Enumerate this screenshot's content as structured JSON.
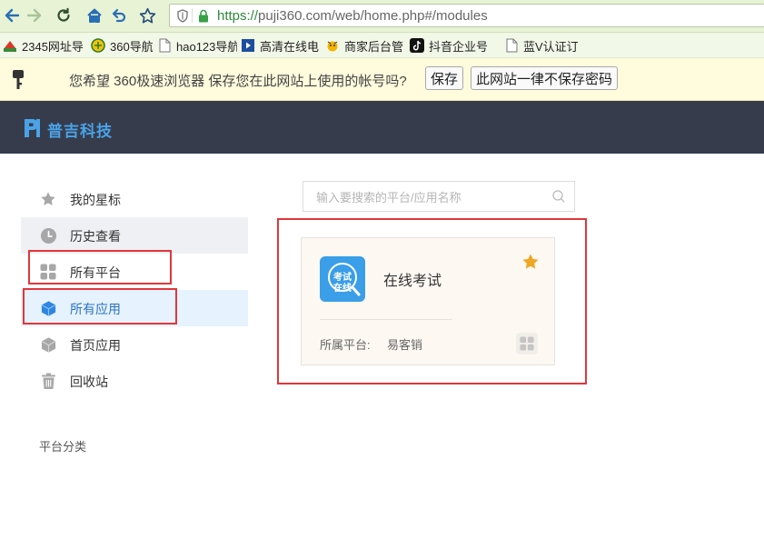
{
  "browser": {
    "url_https": "https://",
    "url_rest": "puji360.com/web/home.php#/modules",
    "bookmarks": [
      {
        "label": "2345网址导",
        "icon": "2345-icon"
      },
      {
        "label": "360导航",
        "icon": "360-icon"
      },
      {
        "label": "hao123导航",
        "icon": "page-icon"
      },
      {
        "label": "高清在线电",
        "icon": "film-icon"
      },
      {
        "label": "商家后台管",
        "icon": "shop-icon"
      },
      {
        "label": "抖音企业号",
        "icon": "tiktok-icon"
      },
      {
        "label": "蓝V认证订",
        "icon": "page-icon"
      }
    ]
  },
  "password_bar": {
    "message": "您希望 360极速浏览器 保存您在此网站上使用的帐号吗?",
    "save_label": "保存",
    "never_label": "此网站一律不保存密码"
  },
  "header": {
    "brand": "普吉科技"
  },
  "sidebar": {
    "items": [
      {
        "label": "我的星标",
        "icon": "star-icon"
      },
      {
        "label": "历史查看",
        "icon": "clock-icon"
      },
      {
        "label": "所有平台",
        "icon": "grid-icon"
      },
      {
        "label": "所有应用",
        "icon": "cube-icon"
      },
      {
        "label": "首页应用",
        "icon": "box-icon"
      },
      {
        "label": "回收站",
        "icon": "trash-icon"
      }
    ],
    "section_label": "平台分类"
  },
  "search": {
    "placeholder": "输入要搜索的平台/应用名称"
  },
  "card": {
    "logo_line1": "考试",
    "logo_line2": "在线",
    "title": "在线考试",
    "platform_label": "所属平台:",
    "platform_value": "易客销"
  },
  "colors": {
    "header_bg": "#363c4c",
    "accent": "#2b74c6",
    "highlight_box": "#e0373b",
    "star": "#f0a623"
  }
}
